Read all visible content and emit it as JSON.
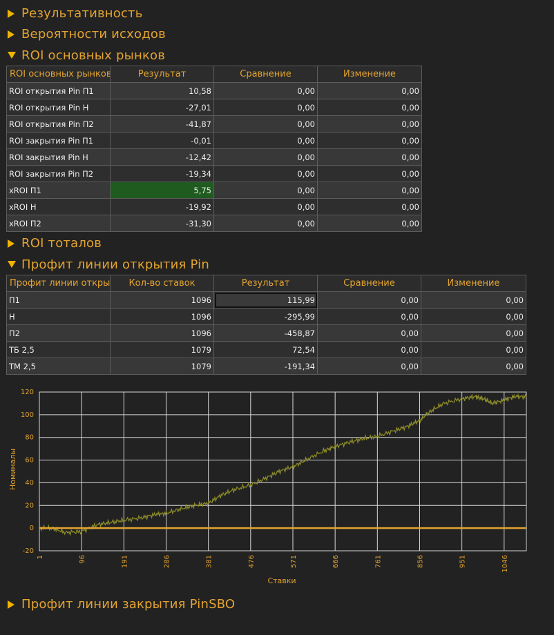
{
  "sections": {
    "s1": "Результативность",
    "s2": "Вероятности исходов",
    "s3": "ROI основных рынков",
    "s4": "ROI тоталов",
    "s5": "Профит линии открытия Pin",
    "s6": "Профит линии закрытия PinSBO"
  },
  "roi_table": {
    "headers": [
      "ROI основных рынков",
      "Результат",
      "Сравнение",
      "Изменение"
    ],
    "rows": [
      {
        "name": "ROI открытия Pin П1",
        "result": "10,58",
        "compare": "0,00",
        "change": "0,00"
      },
      {
        "name": "ROI открытия Pin Н",
        "result": "-27,01",
        "compare": "0,00",
        "change": "0,00"
      },
      {
        "name": "ROI открытия Pin П2",
        "result": "-41,87",
        "compare": "0,00",
        "change": "0,00"
      },
      {
        "name": "ROI закрытия Pin П1",
        "result": "-0,01",
        "compare": "0,00",
        "change": "0,00"
      },
      {
        "name": "ROI закрытия Pin Н",
        "result": "-12,42",
        "compare": "0,00",
        "change": "0,00"
      },
      {
        "name": "ROI закрытия Pin П2",
        "result": "-19,34",
        "compare": "0,00",
        "change": "0,00"
      },
      {
        "name": "xROI П1",
        "result": "5,75",
        "compare": "0,00",
        "change": "0,00"
      },
      {
        "name": "xROI Н",
        "result": "-19,92",
        "compare": "0,00",
        "change": "0,00"
      },
      {
        "name": "xROI П2",
        "result": "-31,30",
        "compare": "0,00",
        "change": "0,00"
      }
    ]
  },
  "profit_table": {
    "headers": [
      "Профит линии открытия Pin",
      "Кол-во ставок",
      "Результат",
      "Сравнение",
      "Изменение"
    ],
    "rows": [
      {
        "name": "П1",
        "count": "1096",
        "result": "115,99",
        "compare": "0,00",
        "change": "0,00"
      },
      {
        "name": "Н",
        "count": "1096",
        "result": "-295,99",
        "compare": "0,00",
        "change": "0,00"
      },
      {
        "name": "П2",
        "count": "1096",
        "result": "-458,87",
        "compare": "0,00",
        "change": "0,00"
      },
      {
        "name": "ТБ 2,5",
        "count": "1079",
        "result": "72,54",
        "compare": "0,00",
        "change": "0,00"
      },
      {
        "name": "ТМ 2,5",
        "count": "1079",
        "result": "-191,34",
        "compare": "0,00",
        "change": "0,00"
      }
    ]
  },
  "colors": {
    "accent": "#e3a32f",
    "line": "#8a8a2a",
    "zero": "#e3a32f",
    "highlight": "#1f5a1f"
  },
  "chart_data": {
    "type": "line",
    "xlabel": "Ставки",
    "ylabel": "Номиналы",
    "xlim": [
      1,
      1096
    ],
    "ylim": [
      -20,
      120
    ],
    "x_ticks": [
      "1",
      "96",
      "191",
      "286",
      "381",
      "476",
      "571",
      "666",
      "761",
      "856",
      "951",
      "1046"
    ],
    "y_ticks": [
      "-20",
      "0",
      "20",
      "40",
      "60",
      "80",
      "100",
      "120"
    ],
    "grid": true,
    "series": [
      {
        "x": [
          1,
          30,
          60,
          96,
          130,
          160,
          191,
          230,
          260,
          286,
          320,
          350,
          381,
          410,
          440,
          476,
          510,
          540,
          571,
          600,
          640,
          666,
          700,
          730,
          761,
          800,
          830,
          856,
          880,
          910,
          951,
          980,
          1000,
          1020,
          1046,
          1070,
          1096
        ],
        "y": [
          0,
          0,
          -4,
          -3,
          3,
          5,
          7,
          9,
          12,
          13,
          17,
          20,
          22,
          29,
          34,
          38,
          44,
          50,
          54,
          60,
          68,
          72,
          76,
          79,
          81,
          86,
          90,
          95,
          103,
          110,
          114,
          116,
          114,
          110,
          113,
          116,
          116
        ]
      },
      {
        "x": [
          1,
          1096
        ],
        "y": [
          0,
          0
        ]
      }
    ]
  }
}
